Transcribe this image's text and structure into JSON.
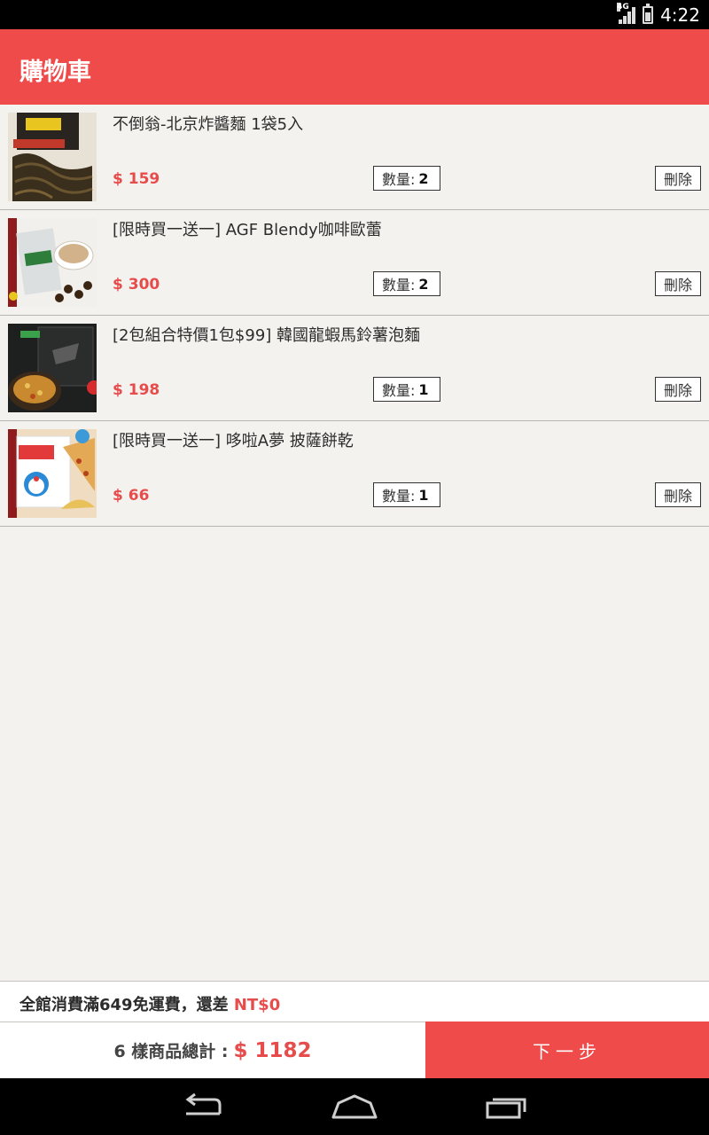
{
  "status_bar": {
    "network": "4G",
    "time": "4:22"
  },
  "app_bar": {
    "title": "購物車"
  },
  "cart": {
    "qty_label": "數量: ",
    "delete_label": "刪除",
    "items": [
      {
        "name": "不倒翁-北京炸醬麵 1袋5入",
        "price": "$ 159",
        "qty": "2"
      },
      {
        "name": "[限時買一送一] AGF Blendy咖啡歐蕾",
        "price": "$ 300",
        "qty": "2"
      },
      {
        "name": "[2包組合特價1包$99] 韓國龍蝦馬鈴薯泡麵",
        "price": "$ 198",
        "qty": "1"
      },
      {
        "name": "[限時買一送一]  哆啦A夢 披薩餅乾",
        "price": "$ 66",
        "qty": "1"
      }
    ]
  },
  "promo": {
    "text": "全館消費滿649免運費，還差 ",
    "amount": "NT$0"
  },
  "summary": {
    "label": "6 樣商品總計 : ",
    "total": "$ 1182",
    "next_label": "下一步"
  },
  "colors": {
    "accent": "#ef4b4b",
    "price": "#e74c4c",
    "background": "#f4f2ee"
  }
}
